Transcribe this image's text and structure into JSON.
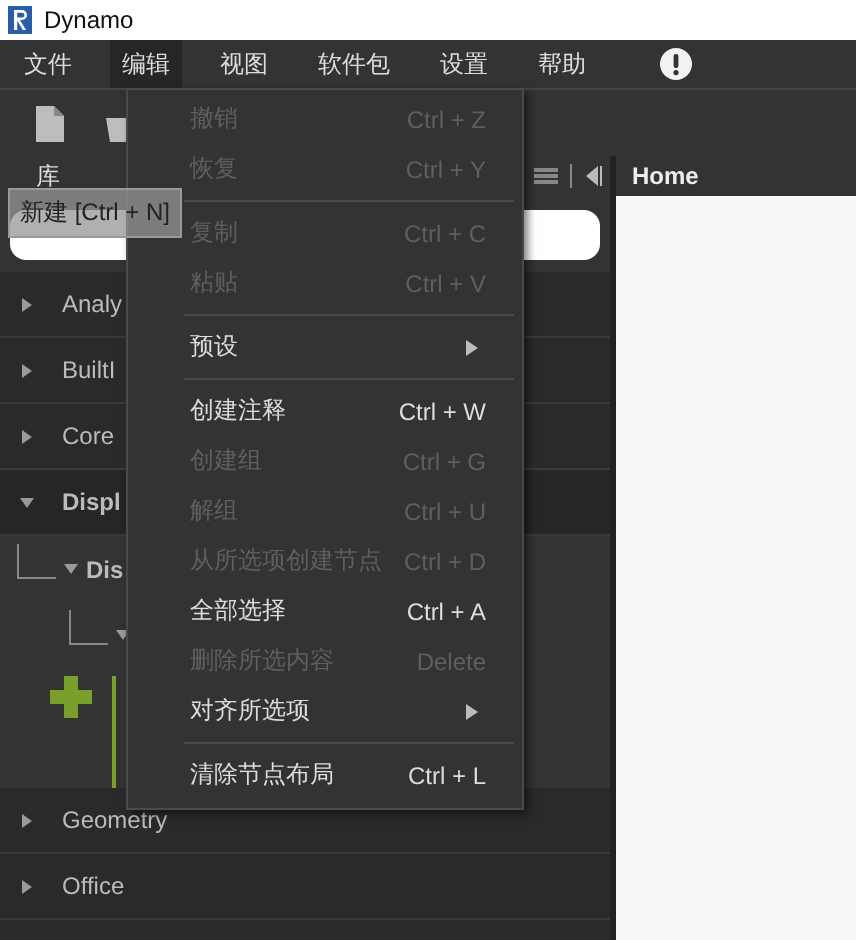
{
  "window": {
    "title": "Dynamo"
  },
  "menubar": [
    {
      "label": "文件",
      "selected": false
    },
    {
      "label": "编辑",
      "selected": true
    },
    {
      "label": "视图",
      "selected": false
    },
    {
      "label": "软件包",
      "selected": false
    },
    {
      "label": "设置",
      "selected": false
    },
    {
      "label": "帮助",
      "selected": false
    }
  ],
  "library": {
    "title": "库",
    "tooltip": "新建 [Ctrl + N]",
    "categories": [
      {
        "label": "Analy",
        "expanded": false
      },
      {
        "label": "BuiltI",
        "expanded": false
      },
      {
        "label": "Core",
        "expanded": false
      },
      {
        "label": "Displ",
        "expanded": true,
        "children": [
          {
            "label": "Dis",
            "expanded": true,
            "children": [
              {
                "expanded": true
              }
            ]
          }
        ]
      },
      {
        "label": "Geometry",
        "expanded": false
      },
      {
        "label": "Office",
        "expanded": false
      }
    ]
  },
  "home_tab": {
    "label": "Home"
  },
  "edit_menu": [
    {
      "kind": "item",
      "label": "撤销",
      "shortcut": "Ctrl + Z",
      "disabled": true
    },
    {
      "kind": "item",
      "label": "恢复",
      "shortcut": "Ctrl + Y",
      "disabled": true
    },
    {
      "kind": "separator"
    },
    {
      "kind": "item",
      "label": "复制",
      "shortcut": "Ctrl + C",
      "disabled": true
    },
    {
      "kind": "item",
      "label": "粘贴",
      "shortcut": "Ctrl + V",
      "disabled": true
    },
    {
      "kind": "separator"
    },
    {
      "kind": "submenu",
      "label": "预设",
      "disabled": false
    },
    {
      "kind": "separator"
    },
    {
      "kind": "item",
      "label": "创建注释",
      "shortcut": "Ctrl + W",
      "disabled": false
    },
    {
      "kind": "item",
      "label": "创建组",
      "shortcut": "Ctrl + G",
      "disabled": true
    },
    {
      "kind": "item",
      "label": "解组",
      "shortcut": "Ctrl + U",
      "disabled": true
    },
    {
      "kind": "item",
      "label": "从所选项创建节点",
      "shortcut": "Ctrl + D",
      "disabled": true
    },
    {
      "kind": "item",
      "label": "全部选择",
      "shortcut": "Ctrl + A",
      "disabled": false
    },
    {
      "kind": "item",
      "label": "删除所选内容",
      "shortcut": "Delete",
      "disabled": true
    },
    {
      "kind": "submenu",
      "label": "对齐所选项",
      "disabled": false
    },
    {
      "kind": "separator"
    },
    {
      "kind": "item",
      "label": "清除节点布局",
      "shortcut": "Ctrl + L",
      "disabled": false
    }
  ]
}
